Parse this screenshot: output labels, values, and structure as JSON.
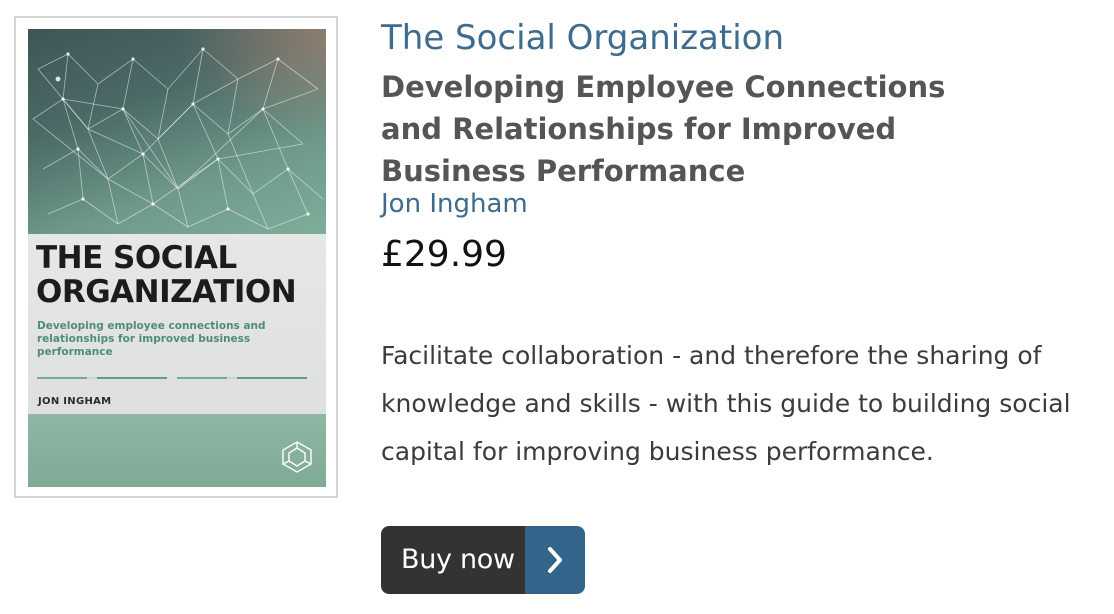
{
  "book": {
    "cover": {
      "title": "THE SOCIAL ORGANIZATION",
      "subtitle": "Developing employee connections and relationships for improved business performance",
      "author": "JON INGHAM"
    },
    "title": "The Social Organization",
    "subtitle": "Developing Employee Connections and Relationships for Improved Business Performance",
    "author": "Jon Ingham",
    "price": "£29.99",
    "description": "Facilitate collaboration - and therefore the sharing of knowledge and skills - with this guide to building social capital for improving business performance."
  },
  "buy_button": {
    "label": "Buy now",
    "icon": "chevron-right-icon"
  },
  "colors": {
    "link": "#3e6b8e",
    "button_dark": "#333333",
    "button_accent": "#33658a",
    "body_text": "#3b3b3b"
  }
}
